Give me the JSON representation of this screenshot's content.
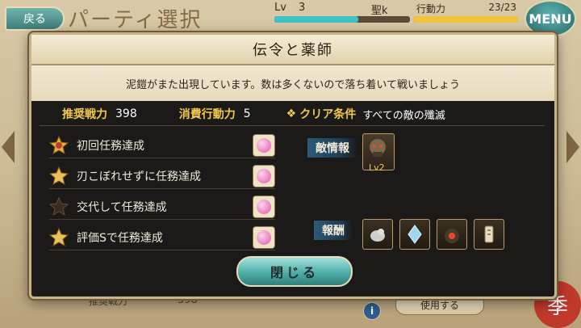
{
  "hud": {
    "back_label": "戻る",
    "screen_title": "パーティ選択",
    "level_label": "Lv",
    "level_value": "3",
    "level_progress": 0.62,
    "rank_label": "聖k",
    "stamina_label": "行動力",
    "stamina_value": "23/23",
    "stamina_progress": 1.0,
    "menu_label": "MENU"
  },
  "background": {
    "power_label": "推奨戦力",
    "power_value": "398",
    "use_button": "使用する",
    "info_icon": "i",
    "seal_char": "季"
  },
  "modal": {
    "title": "伝令と薬師",
    "description": "泥鎧がまた出現しています。数は多くないので落ち着いて戦いましょう",
    "recommended_power_label": "推奨戦力",
    "recommended_power_value": "398",
    "stamina_cost_label": "消費行動力",
    "stamina_cost_value": "5",
    "clear_condition_label": "クリア条件",
    "clear_condition_value": "すべての敵の殲滅",
    "missions": [
      {
        "label": "初回任務達成",
        "medal": "gold-medal-icon"
      },
      {
        "label": "刃こぼれせずに任務達成",
        "medal": "gold-star-icon"
      },
      {
        "label": "交代して任務達成",
        "medal": "dark-star-icon"
      },
      {
        "label": "評価Sで任務達成",
        "medal": "gold-star-icon"
      }
    ],
    "enemy_info_label": "敵情報",
    "enemy_level": "Lv2",
    "reward_label": "報酬",
    "rewards": [
      "bird-item-icon",
      "crystal-item-icon",
      "bomb-item-icon",
      "charm-item-icon"
    ],
    "close_button": "閉じる"
  },
  "colors": {
    "accent_teal": "#4aa8a4",
    "gold_text": "#f2c94c",
    "modal_bg": "#1c1a18"
  }
}
